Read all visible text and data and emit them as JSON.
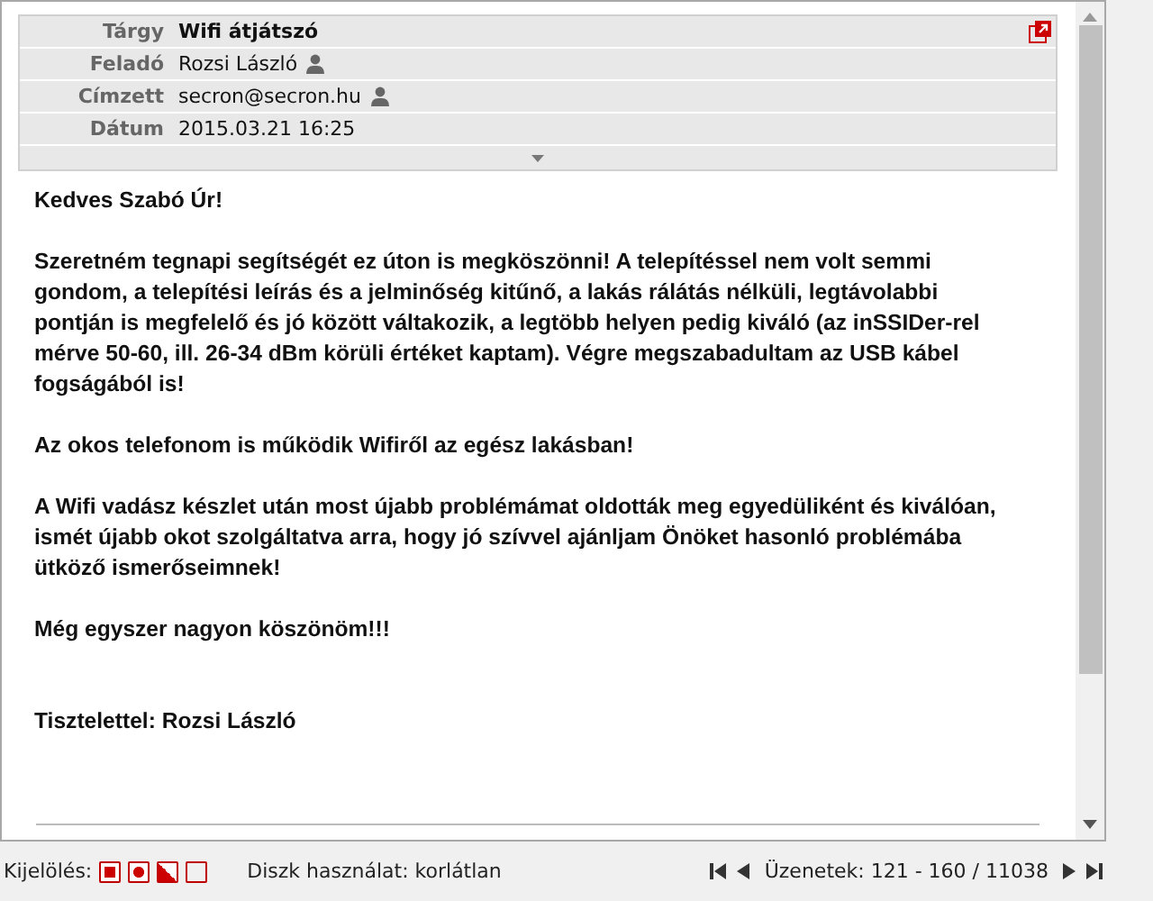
{
  "header": {
    "fields": [
      {
        "label": "Tárgy",
        "value": "Wifi átjátszó",
        "kind": "subject"
      },
      {
        "label": "Feladó",
        "value": "Rozsi László",
        "kind": "contact"
      },
      {
        "label": "Címzett",
        "value": "secron@secron.hu",
        "kind": "contact"
      },
      {
        "label": "Dátum",
        "value": "2015.03.21 16:25",
        "kind": "plain"
      }
    ]
  },
  "body": {
    "paragraphs": [
      "Kedves Szabó Úr!",
      "Szeretném tegnapi segítségét ez úton is megköszönni! A telepítéssel nem volt semmi gondom, a telepítési leírás és a jelminőség kitűnő, a lakás rálátás nélküli, legtávolabbi pontján is megfelelő és jó között váltakozik, a legtöbb helyen pedig kiváló (az inSSIDer-rel mérve 50-60, ill. 26-34 dBm körüli értéket kaptam). Végre megszabadultam az USB kábel fogságából is!",
      "Az okos telefonom is működik Wifiről az egész lakásban!",
      "A Wifi vadász készlet után most újabb problémámat oldották meg egyedüliként és kiválóan, ismét újabb okot szolgáltatva arra, hogy jó szívvel ajánljam Önöket hasonló problémába ütköző ismerőseimnek!",
      "Még egyszer nagyon köszönöm!!!"
    ],
    "closing": "Tisztelettel: Rozsi László"
  },
  "status_bar": {
    "selection_label": "Kijelölés:",
    "disk_usage": "Diszk használat: korlátlan",
    "messages": "Üzenetek: 121 - 160 / 11038"
  }
}
